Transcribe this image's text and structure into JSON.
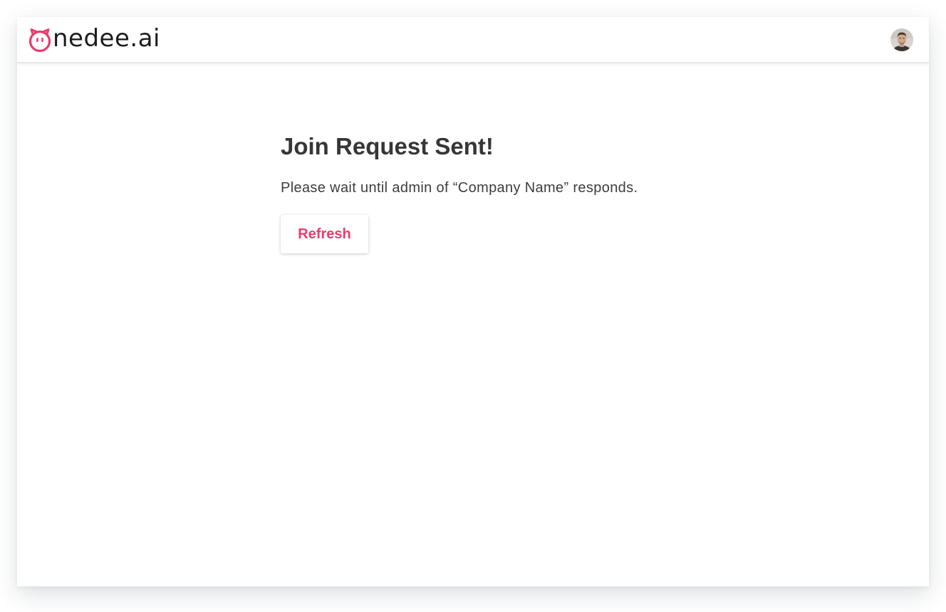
{
  "header": {
    "logo_text": "nedee.ai",
    "logo_icon": "onedee-o-face-icon",
    "avatar_icon": "user-avatar-icon"
  },
  "main": {
    "title": "Join Request Sent!",
    "message": "Please wait until admin of “Company Name” responds.",
    "refresh_label": "Refresh"
  },
  "colors": {
    "brand_accent": "#ec3a6c",
    "title_text": "#363636",
    "body_text": "#3d3d3d",
    "logo_text": "#1d1d1d"
  }
}
